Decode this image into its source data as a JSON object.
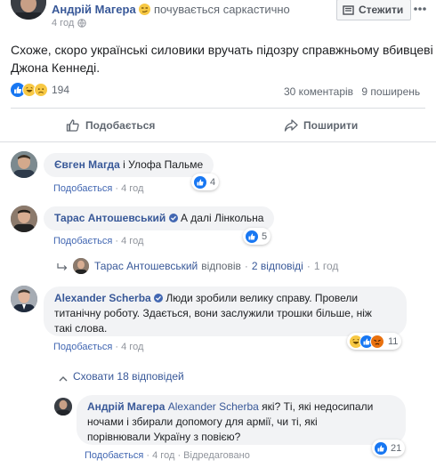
{
  "post": {
    "author": "Андрій Магера",
    "feeling": "почувається саркастично",
    "timestamp": "4 год",
    "follow_label": "Стежити",
    "text_line1": "Схоже, скоро українські силовики вручать підозру справжньому вбивцеві",
    "text_line2": "Джона Кеннеді.",
    "reaction_count": "194",
    "comments_count": "30 коментарів",
    "shares_count": "9 поширень",
    "like_label": "Подобається",
    "share_label": "Поширити"
  },
  "comments": [
    {
      "author": "Євген Магда",
      "text": "і Улофа Пальме",
      "like_action": "Подобається",
      "time": "4 год",
      "reactions": "4"
    },
    {
      "author": "Тарас Антошевський",
      "text": "А далі Лінкольна",
      "like_action": "Подобається",
      "time": "4 год",
      "reactions": "5",
      "reply_author": "Тарас Антошевський",
      "reply_verb": "відповів",
      "reply_count": "2 відповіді",
      "reply_time": "1 год"
    },
    {
      "author": "Alexander Scherba",
      "text_line1": "Люди зробили велику справу. Провели",
      "text_line2": "титанічну роботу. Здається, вони заслужили трошки більше, ніж",
      "text_line3": "такі слова.",
      "like_action": "Подобається",
      "time": "4 год",
      "reactions": "11",
      "hide_replies": "Сховати 18 відповідей"
    }
  ],
  "reply": {
    "author": "Андрій Магера",
    "mention": "Alexander Scherba",
    "text_line1": "які? Ті, які недосипали",
    "text_line2": "ночами і збирали допомогу для армії, чи ті, які",
    "text_line3": "порівнювали Україну з повією?",
    "like_action": "Подобається",
    "time": "4 год",
    "edited": "Відредаговано",
    "reactions": "21"
  },
  "colors": {
    "link": "#385898",
    "like": "#1877f2",
    "muted": "#90949c"
  }
}
